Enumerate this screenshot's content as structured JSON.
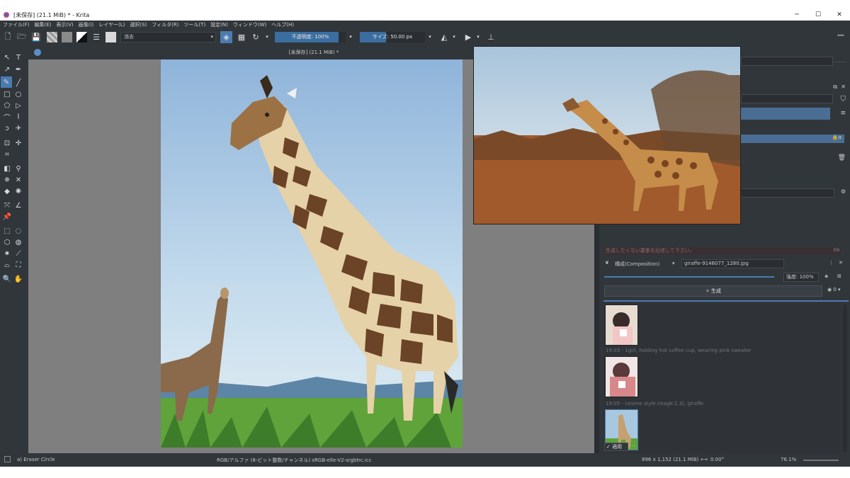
{
  "window": {
    "title": "[未保存]  (21.1 MiB) * - Krita",
    "controls": [
      "─",
      "☐",
      "✕"
    ]
  },
  "menu": [
    "ファイル(F)",
    "編集(E)",
    "表示(V)",
    "画像(I)",
    "レイヤー(L)",
    "選択(S)",
    "フィルタ(R)",
    "ツール(T)",
    "設定(N)",
    "ウィンドウ(W)",
    "ヘルプ(H)"
  ],
  "toolbar": {
    "blend_mode": "消去",
    "opacity_label": "不透明度: 100%",
    "size_label": "サイズ: 50.00 px"
  },
  "document": {
    "tab_title": "[未保存]  (21.1 MiB) *"
  },
  "ai_panel": {
    "negative_prompt_placeholder": "生成したくない要素を記述して下さい。",
    "lang_badge": "EN",
    "mode": "構成(Composition)",
    "control_image": "giraffe-9146077_1280.jpg",
    "strength_label": "強度: 100%",
    "generate_label": "生成",
    "queue_count": "0",
    "history": [
      {
        "caption": "19:03 - 1girl, holding hot coffee cup, wearing pink sweater"
      },
      {
        "caption": "19:05 - (anime style image:1.3), giraffe"
      }
    ],
    "apply_label": "適用"
  },
  "status": {
    "tool": "a) Eraser Circle",
    "color_profile": "RGB/アルファ (8-ビット整数/チャンネル)  sRGB-elle-V2-srgbtrc.icc",
    "dimensions": "896 x 1,152 (21.1 MiB)",
    "rotation": "0.00°",
    "zoom": "76.1%"
  }
}
